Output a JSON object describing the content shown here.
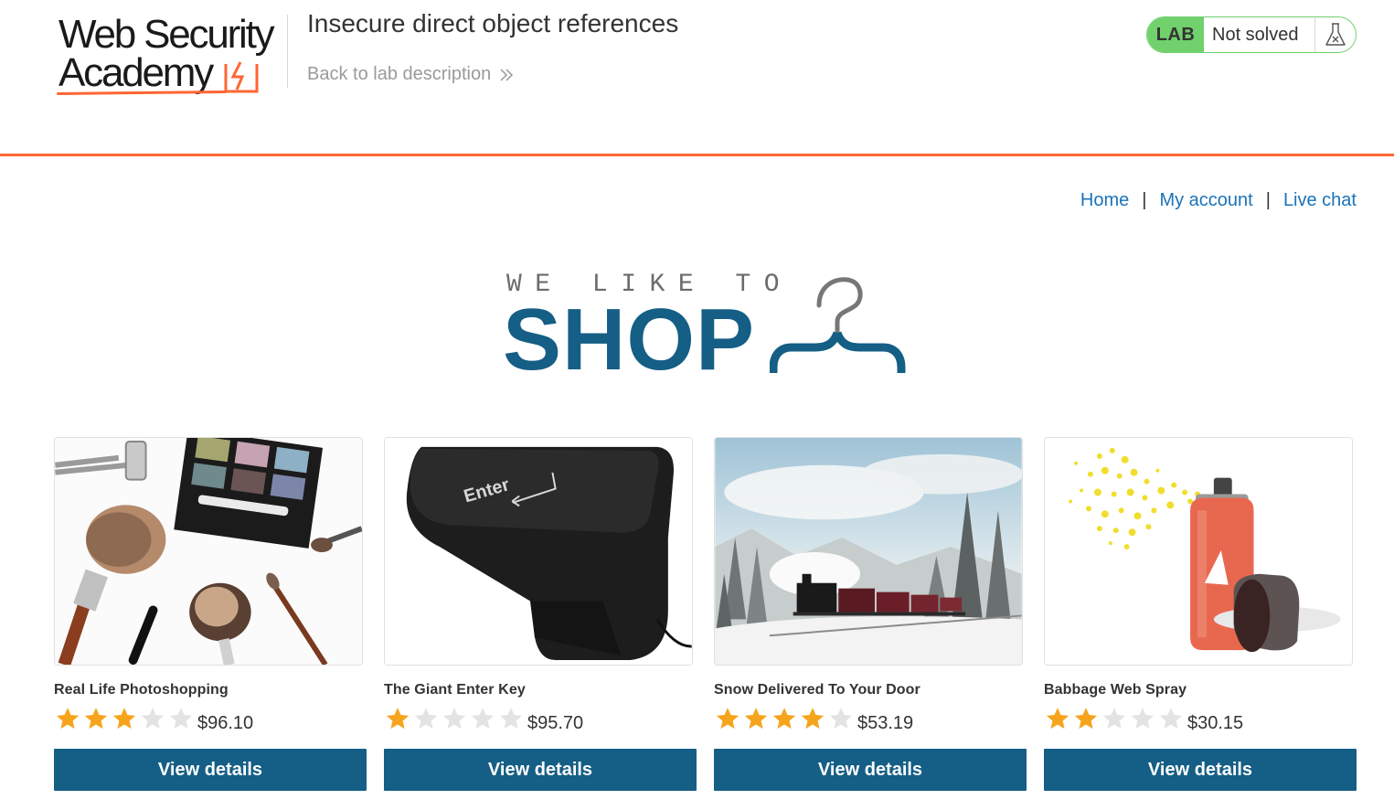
{
  "academy": {
    "logo_line1": "Web Security",
    "logo_line2": "Academy",
    "lab_title": "Insecure direct object references",
    "back_link": "Back to lab description",
    "lab_badge": "LAB",
    "lab_status": "Not solved"
  },
  "nav": {
    "home": "Home",
    "separator": "|",
    "my_account": "My account",
    "live_chat": "Live chat"
  },
  "banner": {
    "tagline": "WE LIKE TO",
    "headline": "SHOP"
  },
  "colors": {
    "accent_orange": "#ff6633",
    "lab_green": "#70d16d",
    "brand_blue": "#155e85",
    "link_blue": "#1a73b9",
    "star_gold": "#f7a41d",
    "star_empty": "#e3e3e3"
  },
  "products": [
    {
      "name": "Real Life Photoshopping",
      "rating": 3,
      "max_rating": 5,
      "price": "$96.10",
      "button": "View details",
      "image_icon": "makeup-brushes-image"
    },
    {
      "name": "The Giant Enter Key",
      "rating": 1,
      "max_rating": 5,
      "price": "$95.70",
      "button": "View details",
      "image_icon": "enter-key-image"
    },
    {
      "name": "Snow Delivered To Your Door",
      "rating": 4,
      "max_rating": 5,
      "price": "$53.19",
      "button": "View details",
      "image_icon": "snow-train-image"
    },
    {
      "name": "Babbage Web Spray",
      "rating": 2,
      "max_rating": 5,
      "price": "$30.15",
      "button": "View details",
      "image_icon": "spray-can-image"
    }
  ]
}
